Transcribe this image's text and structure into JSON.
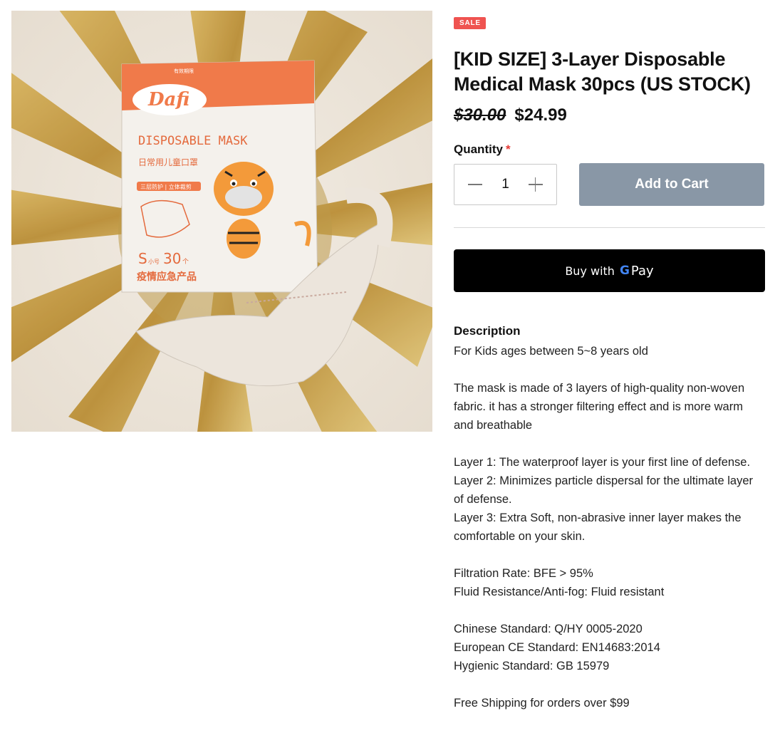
{
  "product": {
    "image_alt": "Dafi disposable kid mask box with tiger mascot",
    "badge": "SALE",
    "title": "[KID SIZE] 3-Layer Disposable Medical Mask 30pcs (US STOCK)",
    "old_price": "$30.00",
    "price": "$24.99"
  },
  "purchase": {
    "quantity_label": "Quantity",
    "required_mark": "*",
    "quantity_value": "1",
    "add_to_cart_label": "Add to Cart",
    "gpay_prefix": "Buy with",
    "gpay_g": "G",
    "gpay_pay": "Pay"
  },
  "description": {
    "heading": "Description",
    "lines": [
      "For Kids ages between 5~8 years old",
      "",
      "The mask is made of 3 layers of high-quality non-woven fabric. it has a stronger filtering effect and is more warm and breathable",
      "",
      "Layer 1: The waterproof layer is your first line of defense.",
      "Layer 2: Minimizes particle dispersal for the ultimate layer of defense.",
      "Layer 3: Extra Soft, non-abrasive inner layer makes the comfortable on your skin.",
      "",
      "Filtration Rate: BFE > 95%",
      "Fluid Resistance/Anti-fog: Fluid resistant",
      "",
      "Chinese Standard: Q/HY 0005-2020",
      "European CE Standard: EN14683:2014",
      "Hygienic Standard: GB 15979",
      "",
      "Free Shipping for orders over $99"
    ]
  },
  "image_text": {
    "brand": "Dafi",
    "product_line": "DISPOSABLE MASK",
    "subtitle_cn": "日常用儿童口罩",
    "features_cn": "三层防护 | 立体裁剪",
    "size": "S",
    "size_small": "小号",
    "count": "30",
    "count_unit": "个",
    "bottom_cn": "疫情应急产品",
    "top_tag": "有效期限"
  },
  "colors": {
    "sale_badge": "#ef5350",
    "add_to_cart": "#8997a6",
    "box_orange": "#f07a4a",
    "gold": "#c9a24a"
  }
}
